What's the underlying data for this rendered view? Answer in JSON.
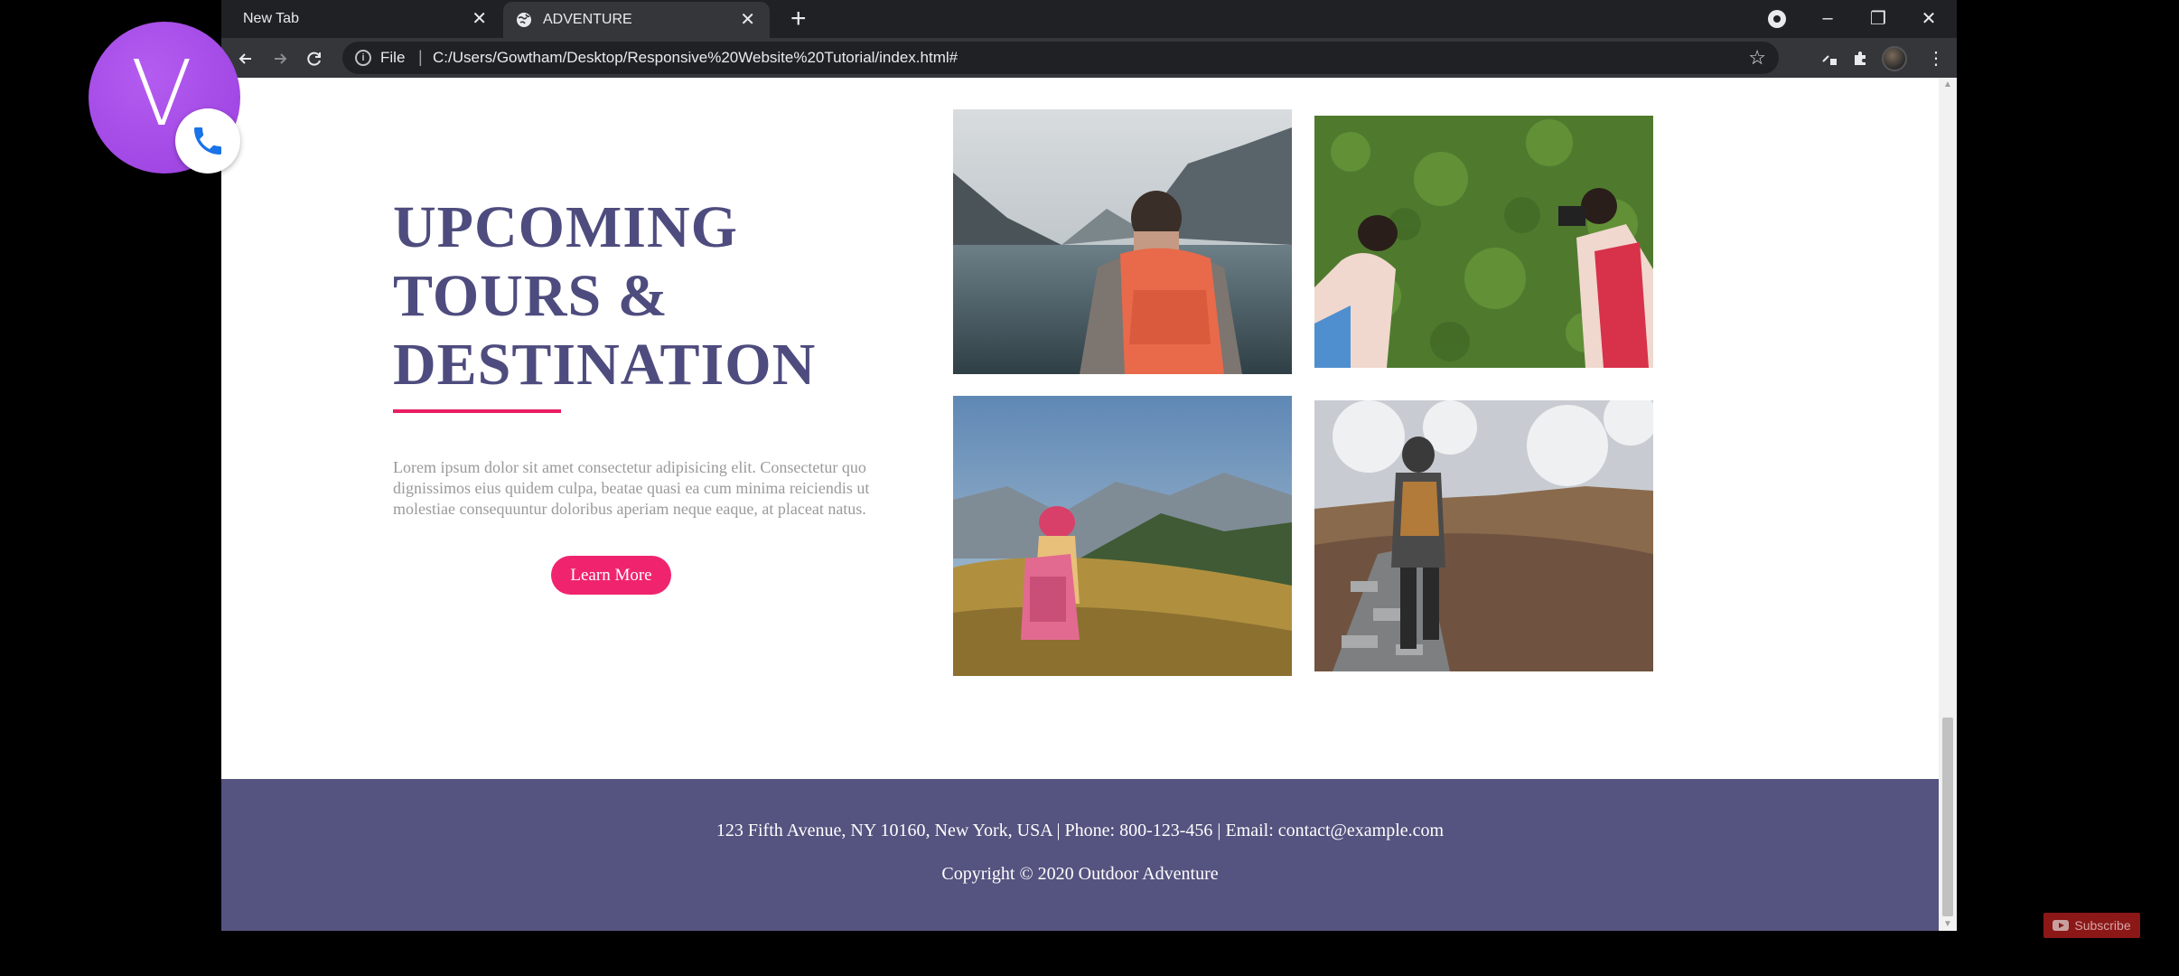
{
  "browser": {
    "tabs": [
      {
        "label": "New Tab"
      },
      {
        "label": "ADVENTURE"
      }
    ],
    "new_tab_symbol": "+",
    "close_symbol": "✕",
    "omnibox": {
      "scheme_label": "File",
      "separator": "|",
      "url": "C:/Users/Gowtham/Desktop/Responsive%20Website%20Tutorial/index.html#"
    },
    "window_controls": {
      "minimize": "–",
      "restore": "❐",
      "close": "✕"
    }
  },
  "page": {
    "heading": "UPCOMING TOURS & DESTINATION",
    "description": "Lorem ipsum dolor sit amet consectetur adipisicing elit. Consectetur quo dignissimos eius quidem culpa, beatae quasi ea cum minima reiciendis ut molestiae consequuntur doloribus aperiam neque eaque, at placeat natus.",
    "cta_label": "Learn More",
    "accent_color": "#f0246e",
    "heading_color": "#4e4c7e",
    "photos": [
      {
        "icon": "hiker-lake-photo"
      },
      {
        "icon": "photographers-grass-photo"
      },
      {
        "icon": "girl-mountains-photo"
      },
      {
        "icon": "hiker-rocky-trail-photo"
      }
    ]
  },
  "footer": {
    "contact": "123 Fifth Avenue, NY 10160, New York, USA | Phone: 800-123-456 | Email: contact@example.com",
    "copyright": "Copyright © 2020 Outdoor Adventure",
    "background": "#55537f"
  },
  "overlay": {
    "call_letter": "V",
    "subscribe_label": "Subscribe"
  }
}
